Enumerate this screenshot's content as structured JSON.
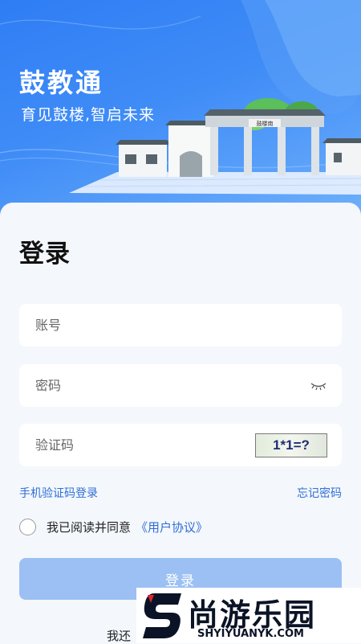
{
  "header": {
    "app_name": "鼓教通",
    "slogan": "育见鼓楼,智启未来",
    "gate_plaque": "鼓楼南"
  },
  "login": {
    "title": "登录",
    "account_placeholder": "账号",
    "password_placeholder": "密码",
    "captcha_placeholder": "验证码",
    "captcha_text": "1*1=?",
    "sms_login_link": "手机验证码登录",
    "forgot_password_link": "忘记密码",
    "agree_text": "我已阅读并同意",
    "agreement_link": "《用户协议》",
    "submit_label": "登录",
    "register_text": "我还"
  },
  "watermark": {
    "name": "尚游乐园",
    "url": "SHYIYUANYK.COM"
  },
  "colors": {
    "hero_blue": "#3f8cf7",
    "link_blue": "#2f6fd6",
    "button_disabled": "#9cc0f3",
    "background": "#f4f7fc"
  }
}
